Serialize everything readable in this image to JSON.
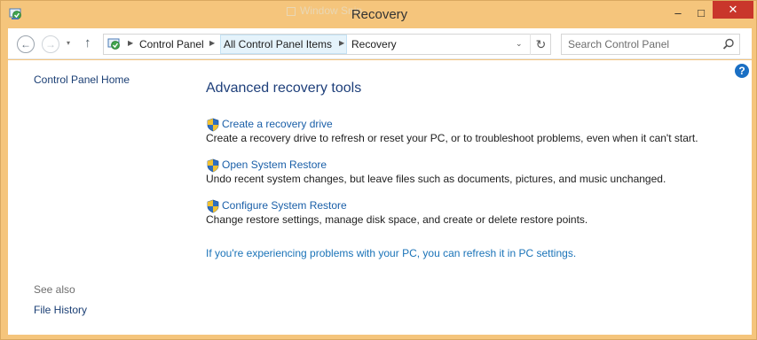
{
  "window": {
    "title": "Recovery",
    "ghost_title": "Window Snip",
    "minimize_glyph": "‒",
    "maximize_glyph": "□",
    "close_glyph": "✕"
  },
  "nav": {
    "back_glyph": "←",
    "forward_glyph": "→",
    "recent_glyph": "▾",
    "up_glyph": "↑"
  },
  "address": {
    "breadcrumbs": [
      "Control Panel",
      "All Control Panel Items",
      "Recovery"
    ],
    "separator_glyph": "▶",
    "dropdown_glyph": "⌄",
    "refresh_glyph": "↻"
  },
  "search": {
    "placeholder": "Search Control Panel"
  },
  "help_glyph": "?",
  "left_pane": {
    "home_link": "Control Panel Home",
    "see_also_label": "See also",
    "see_also_links": [
      "File History"
    ]
  },
  "main": {
    "heading": "Advanced recovery tools",
    "tasks": [
      {
        "link": "Create a recovery drive",
        "description": "Create a recovery drive to refresh or reset your PC, or to troubleshoot problems, even when it can't start."
      },
      {
        "link": "Open System Restore",
        "description": "Undo recent system changes, but leave files such as documents, pictures, and music unchanged."
      },
      {
        "link": "Configure System Restore",
        "description": "Change restore settings, manage disk space, and create or delete restore points."
      }
    ],
    "refresh_link": "If you're experiencing problems with your PC, you can refresh it in PC settings."
  },
  "colors": {
    "frame": "#f5c57c",
    "close_button": "#c9362b",
    "link_blue": "#1a5fa8",
    "heading_blue": "#1e3f7a"
  }
}
